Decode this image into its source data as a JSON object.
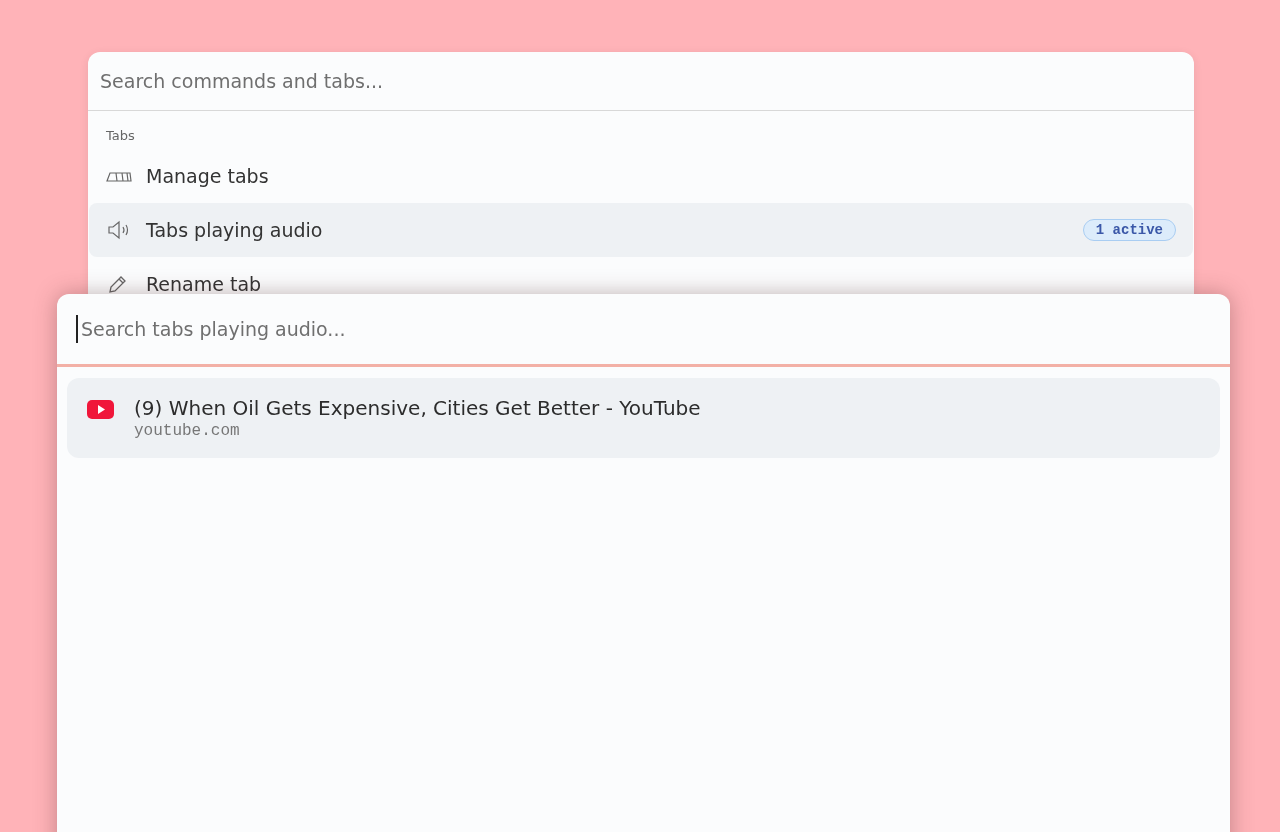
{
  "command_palette": {
    "search": {
      "placeholder": "Search commands and tabs..."
    },
    "section": "Tabs",
    "items": [
      {
        "label": "Manage tabs",
        "kind": "tabs",
        "selected": false
      },
      {
        "label": "Tabs playing audio",
        "kind": "speaker",
        "selected": true,
        "badge": "1 active"
      },
      {
        "label": "Rename tab",
        "kind": "pencil",
        "selected": false
      }
    ]
  },
  "audio_tabs": {
    "search": {
      "placeholder": "Search tabs playing audio...",
      "focused": true
    },
    "loading": true,
    "results": [
      {
        "title": "(9) When Oil Gets Expensive, Cities Get Better - YouTube",
        "url": "youtube.com",
        "selected": true
      }
    ]
  }
}
